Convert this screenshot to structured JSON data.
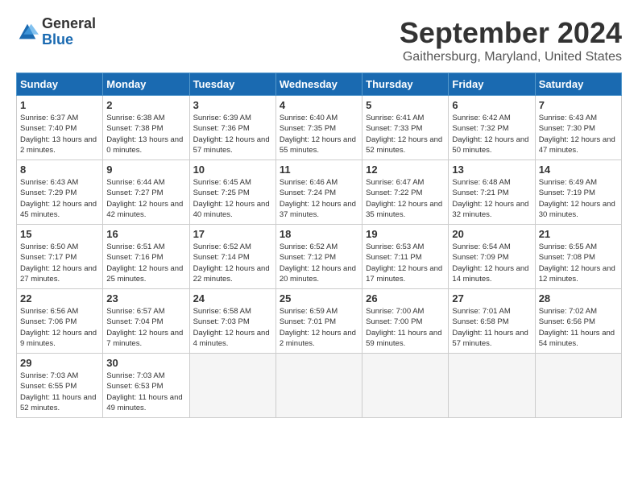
{
  "header": {
    "logo_line1": "General",
    "logo_line2": "Blue",
    "month": "September 2024",
    "location": "Gaithersburg, Maryland, United States"
  },
  "days_of_week": [
    "Sunday",
    "Monday",
    "Tuesday",
    "Wednesday",
    "Thursday",
    "Friday",
    "Saturday"
  ],
  "weeks": [
    [
      {
        "day": 1,
        "sunrise": "6:37 AM",
        "sunset": "7:40 PM",
        "daylight": "13 hours and 2 minutes"
      },
      {
        "day": 2,
        "sunrise": "6:38 AM",
        "sunset": "7:38 PM",
        "daylight": "13 hours and 0 minutes"
      },
      {
        "day": 3,
        "sunrise": "6:39 AM",
        "sunset": "7:36 PM",
        "daylight": "12 hours and 57 minutes"
      },
      {
        "day": 4,
        "sunrise": "6:40 AM",
        "sunset": "7:35 PM",
        "daylight": "12 hours and 55 minutes"
      },
      {
        "day": 5,
        "sunrise": "6:41 AM",
        "sunset": "7:33 PM",
        "daylight": "12 hours and 52 minutes"
      },
      {
        "day": 6,
        "sunrise": "6:42 AM",
        "sunset": "7:32 PM",
        "daylight": "12 hours and 50 minutes"
      },
      {
        "day": 7,
        "sunrise": "6:43 AM",
        "sunset": "7:30 PM",
        "daylight": "12 hours and 47 minutes"
      }
    ],
    [
      {
        "day": 8,
        "sunrise": "6:43 AM",
        "sunset": "7:29 PM",
        "daylight": "12 hours and 45 minutes"
      },
      {
        "day": 9,
        "sunrise": "6:44 AM",
        "sunset": "7:27 PM",
        "daylight": "12 hours and 42 minutes"
      },
      {
        "day": 10,
        "sunrise": "6:45 AM",
        "sunset": "7:25 PM",
        "daylight": "12 hours and 40 minutes"
      },
      {
        "day": 11,
        "sunrise": "6:46 AM",
        "sunset": "7:24 PM",
        "daylight": "12 hours and 37 minutes"
      },
      {
        "day": 12,
        "sunrise": "6:47 AM",
        "sunset": "7:22 PM",
        "daylight": "12 hours and 35 minutes"
      },
      {
        "day": 13,
        "sunrise": "6:48 AM",
        "sunset": "7:21 PM",
        "daylight": "12 hours and 32 minutes"
      },
      {
        "day": 14,
        "sunrise": "6:49 AM",
        "sunset": "7:19 PM",
        "daylight": "12 hours and 30 minutes"
      }
    ],
    [
      {
        "day": 15,
        "sunrise": "6:50 AM",
        "sunset": "7:17 PM",
        "daylight": "12 hours and 27 minutes"
      },
      {
        "day": 16,
        "sunrise": "6:51 AM",
        "sunset": "7:16 PM",
        "daylight": "12 hours and 25 minutes"
      },
      {
        "day": 17,
        "sunrise": "6:52 AM",
        "sunset": "7:14 PM",
        "daylight": "12 hours and 22 minutes"
      },
      {
        "day": 18,
        "sunrise": "6:52 AM",
        "sunset": "7:12 PM",
        "daylight": "12 hours and 20 minutes"
      },
      {
        "day": 19,
        "sunrise": "6:53 AM",
        "sunset": "7:11 PM",
        "daylight": "12 hours and 17 minutes"
      },
      {
        "day": 20,
        "sunrise": "6:54 AM",
        "sunset": "7:09 PM",
        "daylight": "12 hours and 14 minutes"
      },
      {
        "day": 21,
        "sunrise": "6:55 AM",
        "sunset": "7:08 PM",
        "daylight": "12 hours and 12 minutes"
      }
    ],
    [
      {
        "day": 22,
        "sunrise": "6:56 AM",
        "sunset": "7:06 PM",
        "daylight": "12 hours and 9 minutes"
      },
      {
        "day": 23,
        "sunrise": "6:57 AM",
        "sunset": "7:04 PM",
        "daylight": "12 hours and 7 minutes"
      },
      {
        "day": 24,
        "sunrise": "6:58 AM",
        "sunset": "7:03 PM",
        "daylight": "12 hours and 4 minutes"
      },
      {
        "day": 25,
        "sunrise": "6:59 AM",
        "sunset": "7:01 PM",
        "daylight": "12 hours and 2 minutes"
      },
      {
        "day": 26,
        "sunrise": "7:00 AM",
        "sunset": "7:00 PM",
        "daylight": "11 hours and 59 minutes"
      },
      {
        "day": 27,
        "sunrise": "7:01 AM",
        "sunset": "6:58 PM",
        "daylight": "11 hours and 57 minutes"
      },
      {
        "day": 28,
        "sunrise": "7:02 AM",
        "sunset": "6:56 PM",
        "daylight": "11 hours and 54 minutes"
      }
    ],
    [
      {
        "day": 29,
        "sunrise": "7:03 AM",
        "sunset": "6:55 PM",
        "daylight": "11 hours and 52 minutes"
      },
      {
        "day": 30,
        "sunrise": "7:03 AM",
        "sunset": "6:53 PM",
        "daylight": "11 hours and 49 minutes"
      },
      null,
      null,
      null,
      null,
      null
    ]
  ]
}
